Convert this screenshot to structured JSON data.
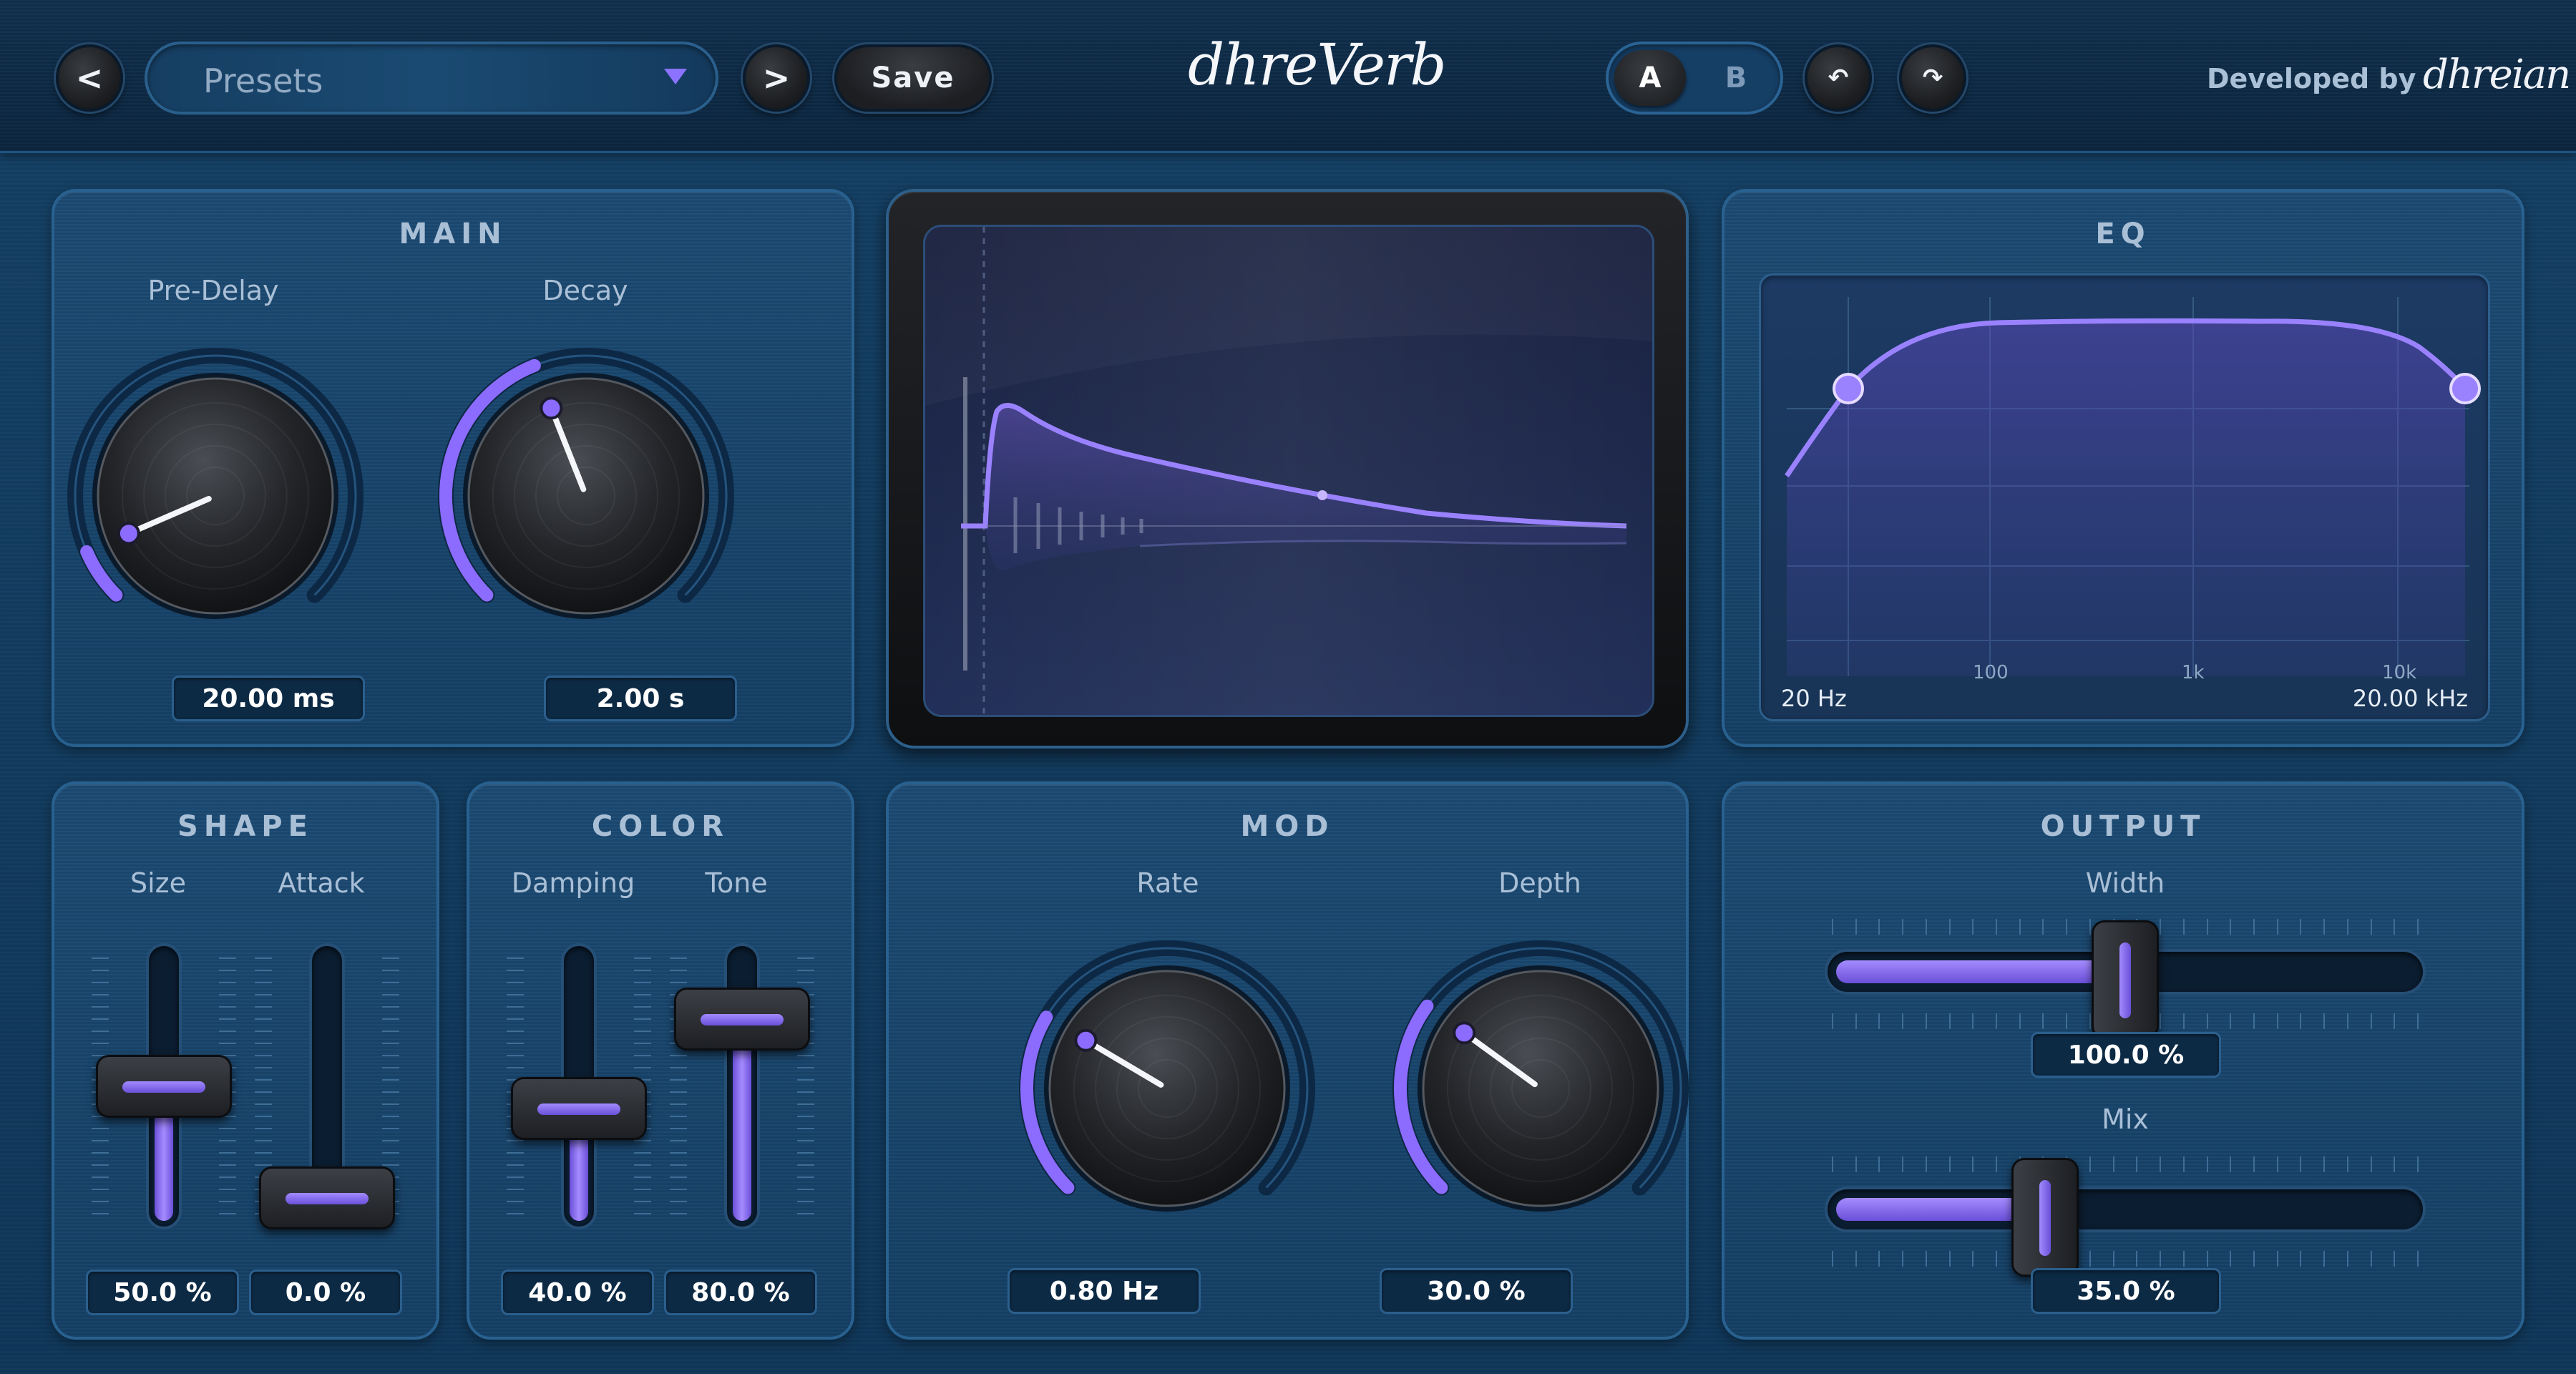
{
  "header": {
    "prev_label": "<",
    "next_label": ">",
    "preset_label": "Presets",
    "save_label": "Save",
    "title": "dhreVerb",
    "ab_a": "A",
    "ab_b": "B",
    "undo_symbol": "↶",
    "redo_symbol": "↷",
    "developed_by": "Developed by",
    "developer_name": "dhreian"
  },
  "main": {
    "title": "MAIN",
    "predelay": {
      "label": "Pre-Delay",
      "value": "20.00 ms",
      "level": 0.08
    },
    "decay": {
      "label": "Decay",
      "value": "2.00 s",
      "level": 0.42
    }
  },
  "eq": {
    "title": "EQ",
    "low_label": "20 Hz",
    "high_label": "20.00 kHz",
    "ticks": [
      "100",
      "1k",
      "10k"
    ]
  },
  "shape": {
    "title": "SHAPE",
    "size": {
      "label": "Size",
      "value": "50.0 %",
      "level": 0.5
    },
    "attack": {
      "label": "Attack",
      "value": "0.0 %",
      "level": 0.0
    }
  },
  "color": {
    "title": "COLOR",
    "damping": {
      "label": "Damping",
      "value": "40.0 %",
      "level": 0.4
    },
    "tone": {
      "label": "Tone",
      "value": "80.0 %",
      "level": 0.8
    }
  },
  "mod": {
    "title": "MOD",
    "rate": {
      "label": "Rate",
      "value": "0.80 Hz",
      "level": 0.28
    },
    "depth": {
      "label": "Depth",
      "value": "30.0 %",
      "level": 0.3
    }
  },
  "output": {
    "title": "OUTPUT",
    "width": {
      "label": "Width",
      "value": "100.0 %",
      "level": 0.5
    },
    "mix": {
      "label": "Mix",
      "value": "35.0 %",
      "level": 0.35
    }
  },
  "colors": {
    "accent": "#8b6cff",
    "panel": "#1b4a72",
    "background": "#123a5c"
  }
}
